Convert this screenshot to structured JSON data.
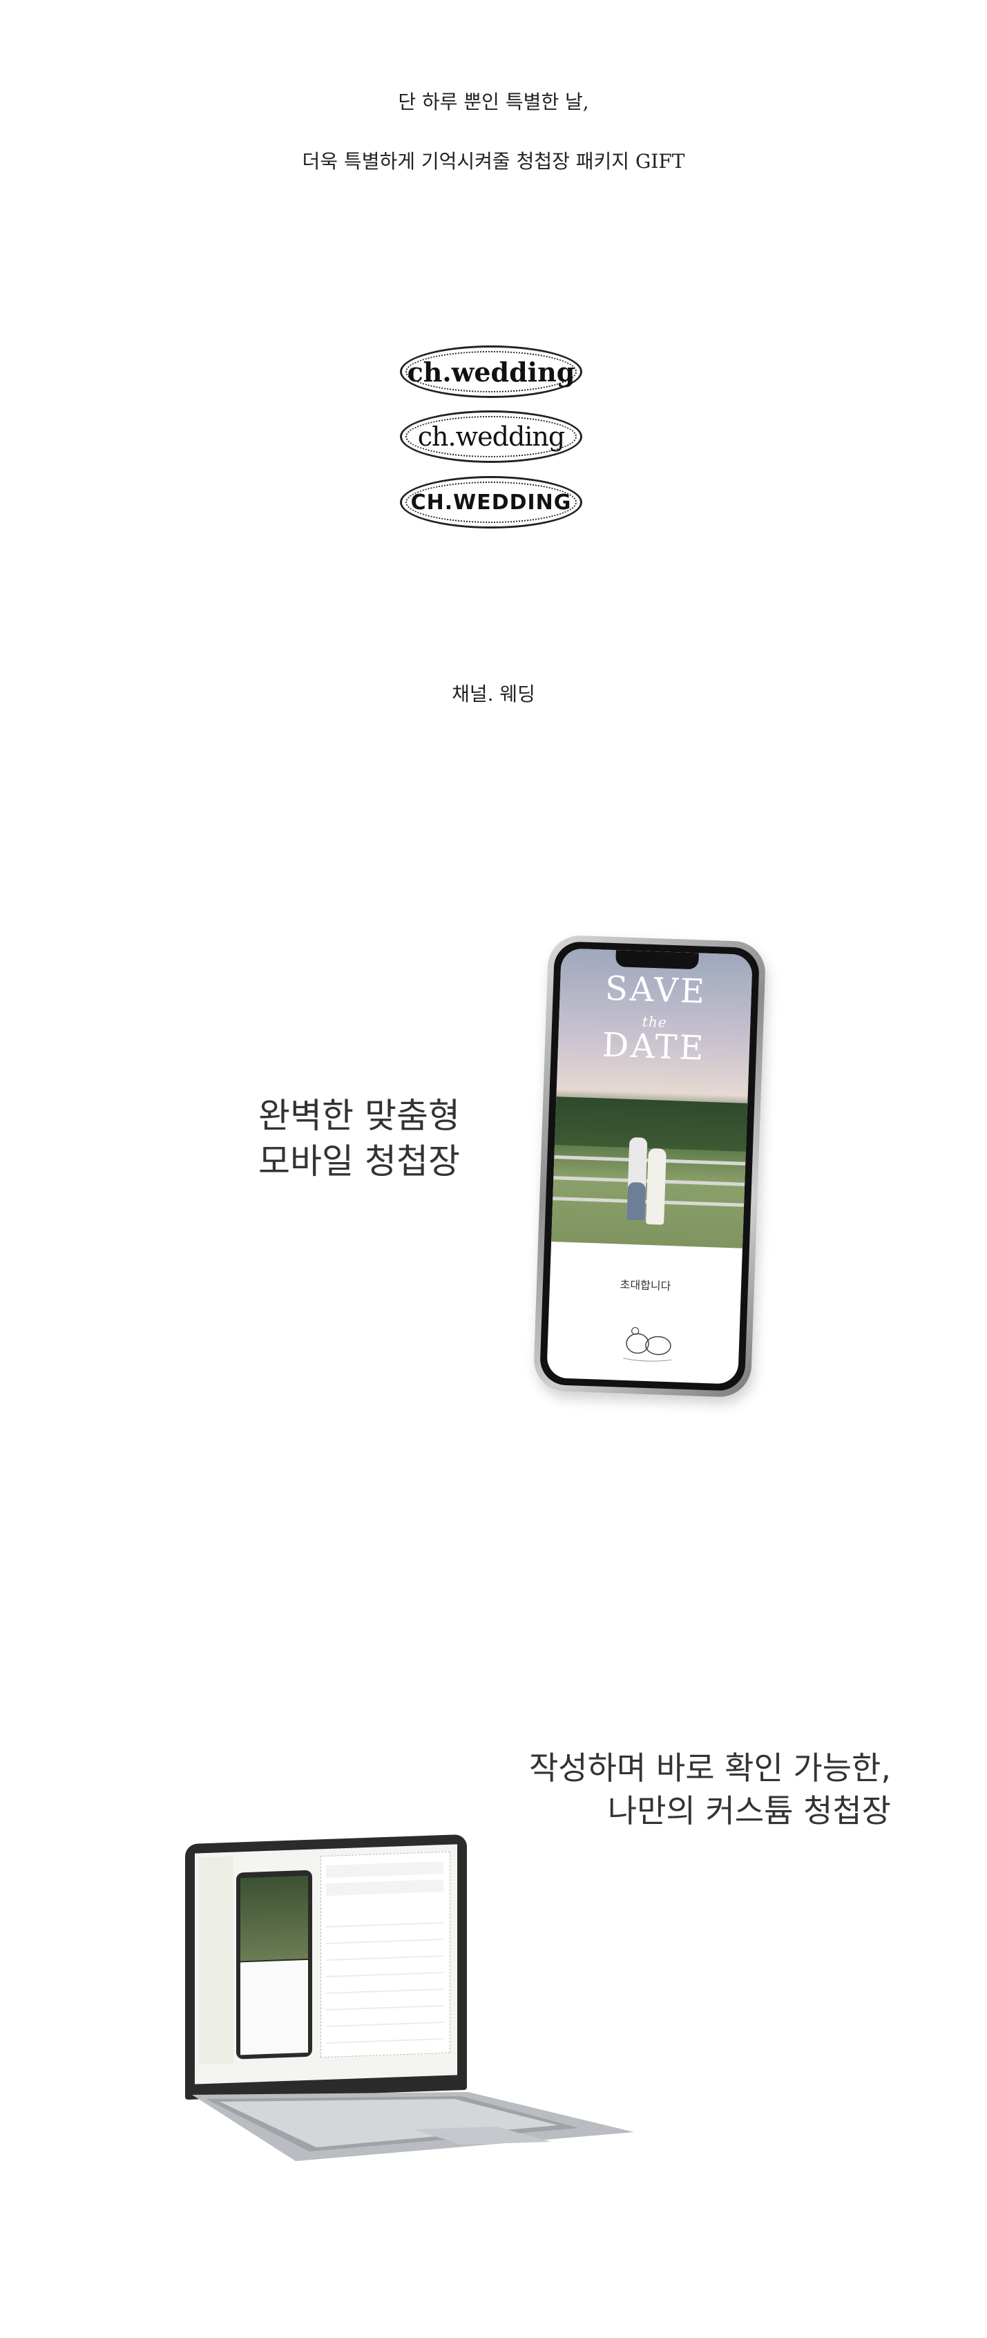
{
  "intro": {
    "line1": "단 하루 뿐인 특별한 날,",
    "line2": "더욱 특별하게 기억시켜줄 청첩장 패키지 GIFT"
  },
  "logos": [
    {
      "text": "ch.wedding"
    },
    {
      "text": "ch.wedding"
    },
    {
      "text": "CH.WEDDING"
    }
  ],
  "brand_name": "채널. 웨딩",
  "mobile_section": {
    "headline_line1": "완벽한 맞춤형",
    "headline_line2": "모바일 청첩장",
    "phone_screen": {
      "save": "SAVE",
      "the": "the",
      "date": "DATE",
      "invite_text": "초대합니다"
    }
  },
  "laptop_section": {
    "headline_line1": "작성하며 바로 확인 가능한,",
    "headline_line2": "나만의 커스튬 청첩장"
  },
  "colors": {
    "background": "#ffffff",
    "text": "#222222"
  }
}
